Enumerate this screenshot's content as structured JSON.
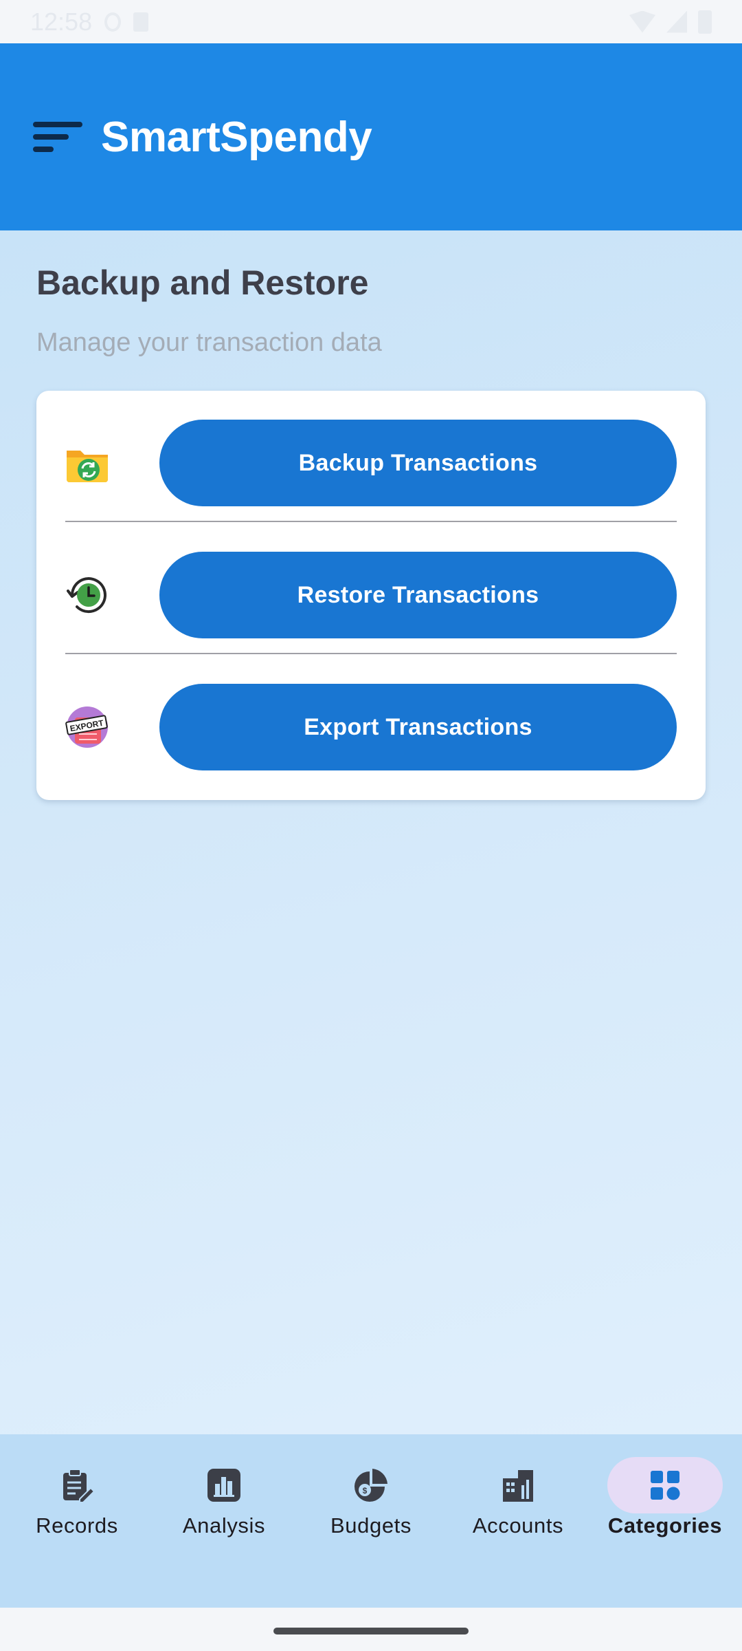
{
  "status_bar": {
    "time": "12:58"
  },
  "app_bar": {
    "title": "SmartSpendy",
    "menu_icon": "menu-icon"
  },
  "page": {
    "heading": "Backup and Restore",
    "subtitle": "Manage your transaction data"
  },
  "actions": [
    {
      "icon": "folder-sync-icon",
      "label": "Backup Transactions"
    },
    {
      "icon": "history-clock-icon",
      "label": "Restore Transactions"
    },
    {
      "icon": "export-badge-icon",
      "label": "Export Transactions",
      "icon_text": "EXPORT"
    }
  ],
  "bottom_nav": {
    "items": [
      {
        "label": "Records",
        "icon": "clipboard-edit-icon",
        "active": false
      },
      {
        "label": "Analysis",
        "icon": "bar-chart-icon",
        "active": false
      },
      {
        "label": "Budgets",
        "icon": "pie-chart-icon",
        "active": false
      },
      {
        "label": "Accounts",
        "icon": "building-icon",
        "active": false
      },
      {
        "label": "Categories",
        "icon": "grid-icon",
        "active": true
      }
    ]
  },
  "colors": {
    "app_bar": "#1e88e5",
    "button": "#1976d2",
    "nav_background": "#bbdcf6",
    "nav_active_pill": "#e6dcf6",
    "active_icon": "#1976d2"
  }
}
